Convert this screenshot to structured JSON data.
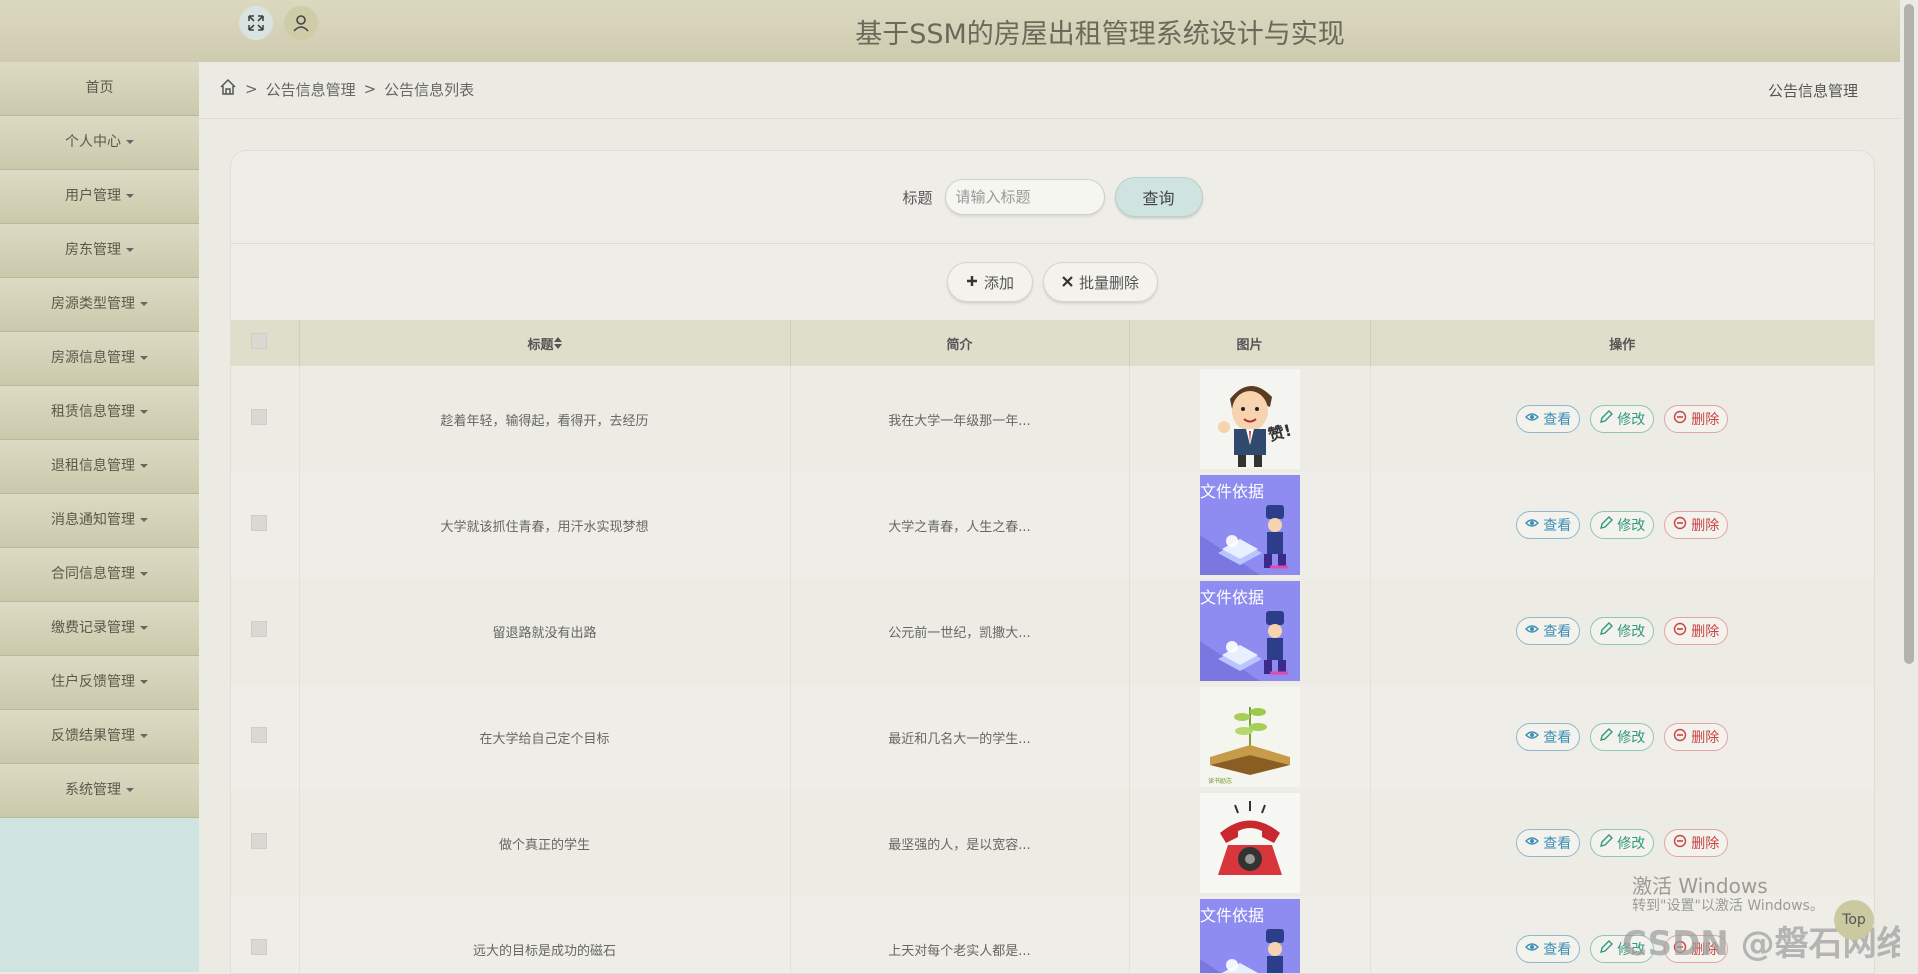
{
  "header": {
    "title": "基于SSM的房屋出租管理系统设计与实现"
  },
  "sidebar": {
    "items": [
      {
        "label": "首页",
        "has_caret": false
      },
      {
        "label": "个人中心",
        "has_caret": true
      },
      {
        "label": "用户管理",
        "has_caret": true
      },
      {
        "label": "房东管理",
        "has_caret": true
      },
      {
        "label": "房源类型管理",
        "has_caret": true
      },
      {
        "label": "房源信息管理",
        "has_caret": true
      },
      {
        "label": "租赁信息管理",
        "has_caret": true
      },
      {
        "label": "退租信息管理",
        "has_caret": true
      },
      {
        "label": "消息通知管理",
        "has_caret": true
      },
      {
        "label": "合同信息管理",
        "has_caret": true
      },
      {
        "label": "缴费记录管理",
        "has_caret": true
      },
      {
        "label": "住户反馈管理",
        "has_caret": true
      },
      {
        "label": "反馈结果管理",
        "has_caret": true
      },
      {
        "label": "系统管理",
        "has_caret": true
      }
    ]
  },
  "breadcrumb": {
    "sep": ">",
    "level1": "公告信息管理",
    "level2": "公告信息列表",
    "right_title": "公告信息管理"
  },
  "search": {
    "label": "标题",
    "placeholder": "请输入标题",
    "button": "查询"
  },
  "actions": {
    "add": "添加",
    "batch_delete": "批量删除"
  },
  "table": {
    "headers": {
      "title": "标题",
      "intro": "简介",
      "image": "图片",
      "ops": "操作"
    },
    "op_labels": {
      "view": "查看",
      "edit": "修改",
      "delete": "删除"
    },
    "rows": [
      {
        "title": "趁着年轻，输得起，看得开，去经历",
        "intro": "我在大学一年级那一年...",
        "image": "cartoon-man"
      },
      {
        "title": "大学就该抓住青春，用汗水实现梦想",
        "intro": "大学之青春，人生之春...",
        "image": "document-basis"
      },
      {
        "title": "留退路就没有出路",
        "intro": "公元前一世纪，凯撒大...",
        "image": "document-basis"
      },
      {
        "title": "在大学给自己定个目标",
        "intro": "最近和几名大一的学生...",
        "image": "book-plant"
      },
      {
        "title": "做个真正的学生",
        "intro": "最坚强的人，是以宽容...",
        "image": "red-telephone"
      },
      {
        "title": "远大的目标是成功的磁石",
        "intro": "上天对每个老实人都是...",
        "image": "document-basis"
      }
    ]
  },
  "image_caption": "文件依据",
  "overlay": {
    "watermark_line1": "激活 Windows",
    "watermark_line2": "转到\"设置\"以激活 Windows。",
    "top_button": "Top",
    "csdn": "CSDN @磐石网络"
  },
  "colors": {
    "header_bg": "#d6d3b8",
    "sidebar_item_bg": "#d3d1b5",
    "sidebar_bg": "#cfe3e0",
    "view": "#3b8fb8",
    "edit": "#2f9a80",
    "delete": "#c94444"
  }
}
